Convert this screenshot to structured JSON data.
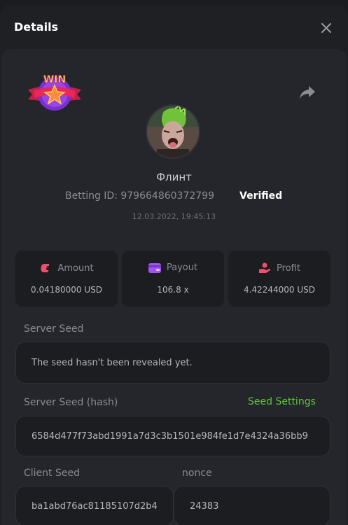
{
  "header": {
    "title": "Details",
    "close_icon": "close-icon"
  },
  "badge": {
    "text": "WIN",
    "icon": "win-star-badge-icon",
    "colors": {
      "ribbon": "#e8285a",
      "circle": "#7b2fd0",
      "star": "#ff8a3d",
      "text": "#ffd84a"
    }
  },
  "share_icon": "share-arrow-icon",
  "user": {
    "name": "Флинт",
    "betting_id_label": "Betting ID: 979664860372799",
    "verified": "Verified",
    "timestamp": "12.03.2022, 19:45:13"
  },
  "stats": [
    {
      "icon": "amount-icon",
      "label": "Amount",
      "value": "0.04180000 USD",
      "color": "#f0506e"
    },
    {
      "icon": "wallet-icon",
      "label": "Payout",
      "value": "106.8 x",
      "color": "#a155f2"
    },
    {
      "icon": "profit-hand-icon",
      "label": "Profit",
      "value": "4.42244000 USD",
      "color": "#f0506e"
    }
  ],
  "server_seed": {
    "label": "Server Seed",
    "value": "The seed hasn't been revealed yet."
  },
  "server_seed_hash": {
    "label": "Server Seed (hash)",
    "link": "Seed Settings",
    "value": "6584d477f73abd1991a7d3c3b1501e984fe1d7e4324a36bb9"
  },
  "client_seed": {
    "label": "Client Seed",
    "value": "ba1abd76ac81185107d2b4"
  },
  "nonce": {
    "label": "nonce",
    "value": "24383"
  },
  "colors": {
    "accent_green": "#5dc53a",
    "panel": "#25262b",
    "card": "#1c1d21"
  }
}
